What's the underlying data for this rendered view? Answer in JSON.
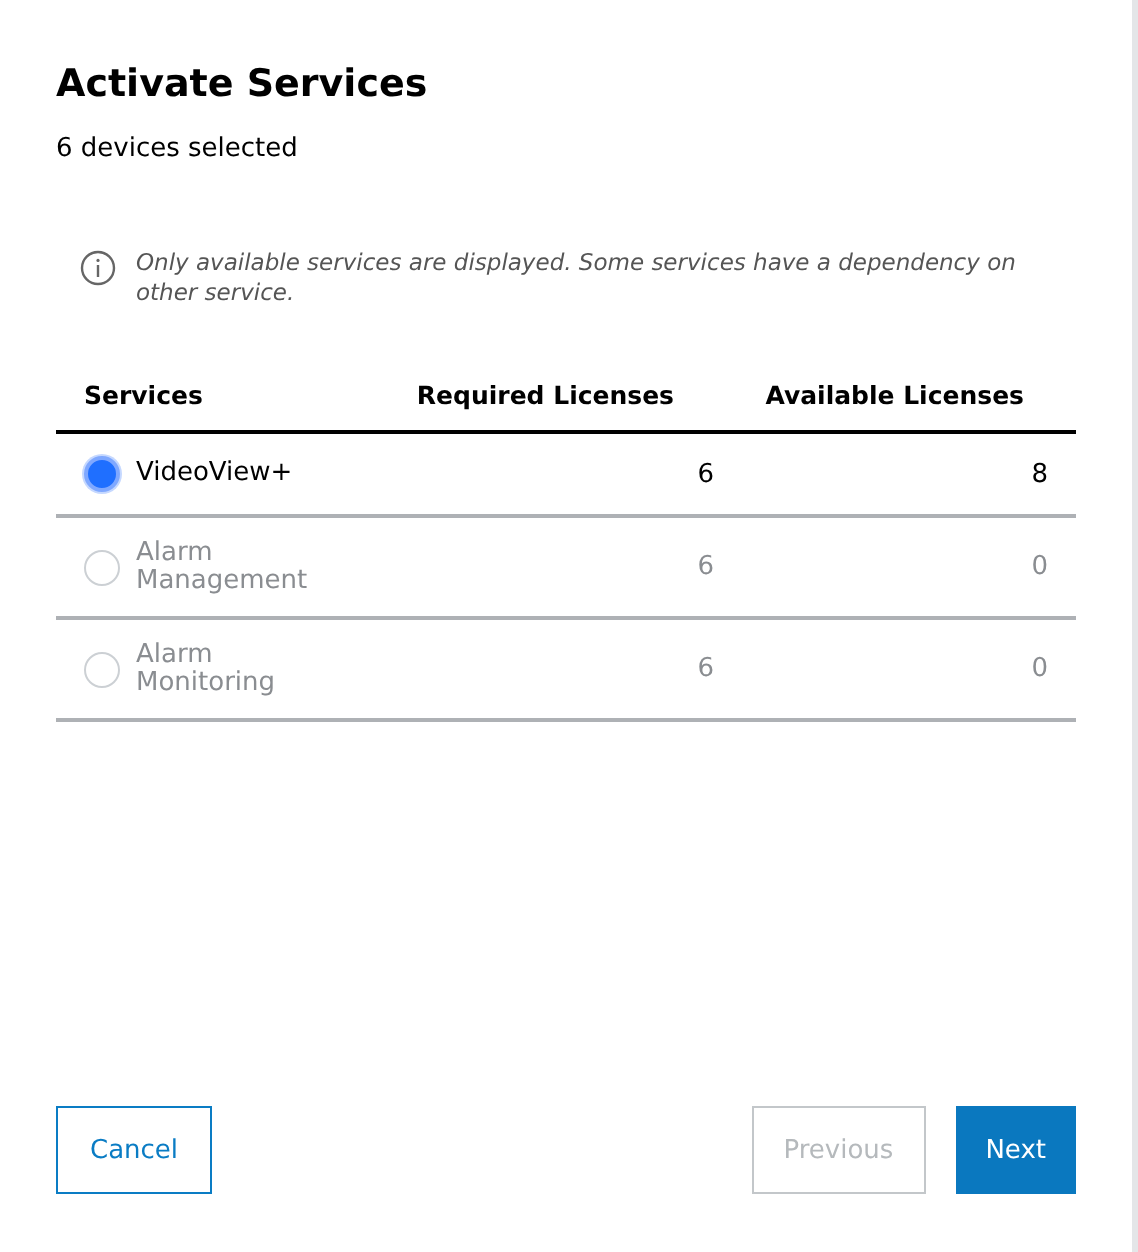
{
  "dialog": {
    "title": "Activate Services",
    "subtitle": "6 devices selected"
  },
  "info": "Only available services are displayed. Some services have a dependency on other service.",
  "table": {
    "columns": [
      "Services",
      "Required Licenses",
      "Available Licenses"
    ],
    "rows": [
      {
        "service": "VideoView+",
        "required": "6",
        "available": "8",
        "selected": true,
        "disabled": false
      },
      {
        "service": "Alarm Management",
        "required": "6",
        "available": "0",
        "selected": false,
        "disabled": true
      },
      {
        "service": "Alarm Monitoring",
        "required": "6",
        "available": "0",
        "selected": false,
        "disabled": true
      }
    ]
  },
  "buttons": [
    {
      "label": "Cancel",
      "kind": "outline",
      "disabled": false
    },
    {
      "label": "Previous",
      "kind": "outline",
      "disabled": true
    },
    {
      "label": "Next",
      "kind": "primary",
      "disabled": false
    }
  ]
}
